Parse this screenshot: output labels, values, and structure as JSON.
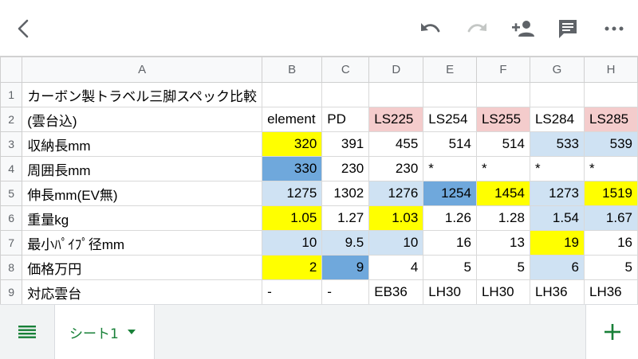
{
  "toolbar": {
    "icons": [
      "back-icon",
      "undo-icon",
      "redo-icon",
      "add-person-icon",
      "comment-icon",
      "more-icon"
    ]
  },
  "columns": [
    "A",
    "B",
    "C",
    "D",
    "E",
    "F",
    "G",
    "H"
  ],
  "rows": [
    {
      "num": "1",
      "cells": [
        {
          "v": "カーボン製トラベル三脚スペック比較",
          "bg": "#ffffff",
          "align": "left",
          "overflow": true
        },
        {
          "v": "",
          "bg": "#ffffff",
          "align": "left"
        },
        {
          "v": "",
          "bg": "#ffffff",
          "align": "left"
        },
        {
          "v": "",
          "bg": "#ffffff",
          "align": "left"
        },
        {
          "v": "",
          "bg": "#ffffff",
          "align": "left"
        },
        {
          "v": "",
          "bg": "#ffffff",
          "align": "left"
        },
        {
          "v": "",
          "bg": "#ffffff",
          "align": "left"
        },
        {
          "v": "",
          "bg": "#ffffff",
          "align": "left"
        }
      ]
    },
    {
      "num": "2",
      "cells": [
        {
          "v": "(雲台込)",
          "bg": "#ffffff",
          "align": "left"
        },
        {
          "v": "element",
          "bg": "#ffffff",
          "align": "left"
        },
        {
          "v": "PD",
          "bg": "#ffffff",
          "align": "left"
        },
        {
          "v": "LS225",
          "bg": "#f4cccc",
          "align": "left"
        },
        {
          "v": "LS254",
          "bg": "#ffffff",
          "align": "left"
        },
        {
          "v": "LS255",
          "bg": "#f4cccc",
          "align": "left"
        },
        {
          "v": "LS284",
          "bg": "#ffffff",
          "align": "left"
        },
        {
          "v": "LS285",
          "bg": "#f4cccc",
          "align": "left"
        }
      ]
    },
    {
      "num": "3",
      "cells": [
        {
          "v": "収納長mm",
          "bg": "#ffffff",
          "align": "left"
        },
        {
          "v": "320",
          "bg": "#ffff00",
          "align": "right"
        },
        {
          "v": "391",
          "bg": "#ffffff",
          "align": "right"
        },
        {
          "v": "455",
          "bg": "#ffffff",
          "align": "right"
        },
        {
          "v": "514",
          "bg": "#ffffff",
          "align": "right"
        },
        {
          "v": "514",
          "bg": "#ffffff",
          "align": "right"
        },
        {
          "v": "533",
          "bg": "#cfe2f3",
          "align": "right"
        },
        {
          "v": "539",
          "bg": "#cfe2f3",
          "align": "right"
        }
      ]
    },
    {
      "num": "4",
      "cells": [
        {
          "v": "周囲長mm",
          "bg": "#ffffff",
          "align": "left"
        },
        {
          "v": "330",
          "bg": "#6fa8dc",
          "align": "right"
        },
        {
          "v": "230",
          "bg": "#ffffff",
          "align": "right"
        },
        {
          "v": "230",
          "bg": "#ffffff",
          "align": "right"
        },
        {
          "v": "*",
          "bg": "#ffffff",
          "align": "left"
        },
        {
          "v": "*",
          "bg": "#ffffff",
          "align": "left"
        },
        {
          "v": "*",
          "bg": "#ffffff",
          "align": "left"
        },
        {
          "v": "*",
          "bg": "#ffffff",
          "align": "left"
        }
      ]
    },
    {
      "num": "5",
      "cells": [
        {
          "v": "伸長mm(EV無)",
          "bg": "#ffffff",
          "align": "left"
        },
        {
          "v": "1275",
          "bg": "#cfe2f3",
          "align": "right"
        },
        {
          "v": "1302",
          "bg": "#ffffff",
          "align": "right"
        },
        {
          "v": "1276",
          "bg": "#cfe2f3",
          "align": "right"
        },
        {
          "v": "1254",
          "bg": "#6fa8dc",
          "align": "right"
        },
        {
          "v": "1454",
          "bg": "#ffff00",
          "align": "right"
        },
        {
          "v": "1273",
          "bg": "#cfe2f3",
          "align": "right"
        },
        {
          "v": "1519",
          "bg": "#ffff00",
          "align": "right"
        }
      ]
    },
    {
      "num": "6",
      "cells": [
        {
          "v": "重量kg",
          "bg": "#ffffff",
          "align": "left"
        },
        {
          "v": "1.05",
          "bg": "#ffff00",
          "align": "right"
        },
        {
          "v": "1.27",
          "bg": "#ffffff",
          "align": "right"
        },
        {
          "v": "1.03",
          "bg": "#ffff00",
          "align": "right"
        },
        {
          "v": "1.26",
          "bg": "#ffffff",
          "align": "right"
        },
        {
          "v": "1.28",
          "bg": "#ffffff",
          "align": "right"
        },
        {
          "v": "1.54",
          "bg": "#cfe2f3",
          "align": "right"
        },
        {
          "v": "1.67",
          "bg": "#cfe2f3",
          "align": "right"
        }
      ]
    },
    {
      "num": "7",
      "cells": [
        {
          "v": "最小ﾊﾟｲﾌﾟ径mm",
          "bg": "#ffffff",
          "align": "left"
        },
        {
          "v": "10",
          "bg": "#cfe2f3",
          "align": "right"
        },
        {
          "v": "9.5",
          "bg": "#cfe2f3",
          "align": "right"
        },
        {
          "v": "10",
          "bg": "#cfe2f3",
          "align": "right"
        },
        {
          "v": "16",
          "bg": "#ffffff",
          "align": "right"
        },
        {
          "v": "13",
          "bg": "#ffffff",
          "align": "right"
        },
        {
          "v": "19",
          "bg": "#ffff00",
          "align": "right"
        },
        {
          "v": "16",
          "bg": "#ffffff",
          "align": "right"
        }
      ]
    },
    {
      "num": "8",
      "cells": [
        {
          "v": "価格万円",
          "bg": "#ffffff",
          "align": "left"
        },
        {
          "v": "2",
          "bg": "#ffff00",
          "align": "right"
        },
        {
          "v": "9",
          "bg": "#6fa8dc",
          "align": "right"
        },
        {
          "v": "4",
          "bg": "#ffffff",
          "align": "right"
        },
        {
          "v": "5",
          "bg": "#ffffff",
          "align": "right"
        },
        {
          "v": "5",
          "bg": "#ffffff",
          "align": "right"
        },
        {
          "v": "6",
          "bg": "#cfe2f3",
          "align": "right"
        },
        {
          "v": "5",
          "bg": "#ffffff",
          "align": "right"
        }
      ]
    },
    {
      "num": "9",
      "cells": [
        {
          "v": "対応雲台",
          "bg": "#ffffff",
          "align": "left"
        },
        {
          "v": "-",
          "bg": "#ffffff",
          "align": "left"
        },
        {
          "v": "-",
          "bg": "#ffffff",
          "align": "left"
        },
        {
          "v": "EB36",
          "bg": "#ffffff",
          "align": "left"
        },
        {
          "v": "LH30",
          "bg": "#ffffff",
          "align": "left"
        },
        {
          "v": "LH30",
          "bg": "#ffffff",
          "align": "left"
        },
        {
          "v": "LH36",
          "bg": "#ffffff",
          "align": "left"
        },
        {
          "v": "LH36",
          "bg": "#ffffff",
          "align": "left"
        }
      ]
    },
    {
      "num": "",
      "cells": [
        {
          "v": "",
          "bg": "#ffffff",
          "align": "left"
        },
        {
          "v": "",
          "bg": "#ffffff",
          "align": "left"
        },
        {
          "v": "",
          "bg": "#ffffff",
          "align": "left"
        },
        {
          "v": "",
          "bg": "#ffffff",
          "align": "left"
        },
        {
          "v": "",
          "bg": "#ffffff",
          "align": "left"
        },
        {
          "v": "",
          "bg": "#ffffff",
          "align": "left"
        },
        {
          "v": "",
          "bg": "#ffffff",
          "align": "left"
        },
        {
          "v": "",
          "bg": "#ffffff",
          "align": "left"
        }
      ]
    }
  ],
  "bottombar": {
    "sheet_tab_label": "シート1",
    "accent_color": "#188038"
  }
}
